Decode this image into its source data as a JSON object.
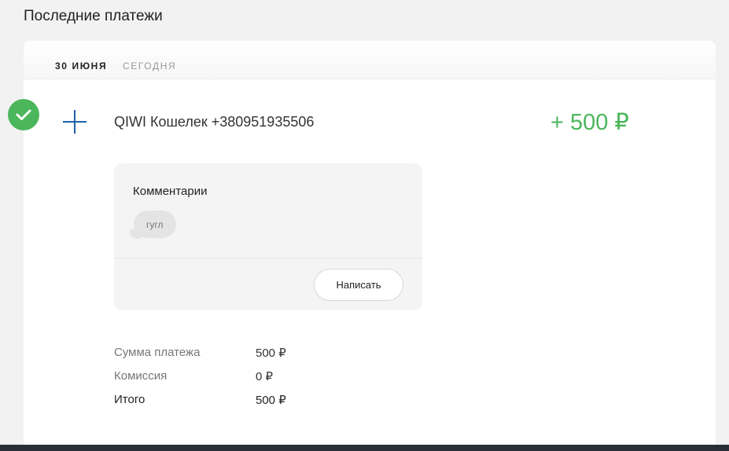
{
  "page": {
    "title": "Последние платежи"
  },
  "date_bar": {
    "date": "30 ИЮНЯ",
    "relative": "СЕГОДНЯ"
  },
  "payment": {
    "status_icon": "check-icon",
    "type_icon": "plus-icon",
    "payee": "QIWI Кошелек +380951935506",
    "amount": "+ 500 ₽",
    "amount_color": "#4cb65c"
  },
  "comments": {
    "title": "Комментарии",
    "items": [
      "гугл"
    ],
    "write_label": "Написать"
  },
  "details": [
    {
      "label": "Сумма платежа",
      "value": "500 ₽"
    },
    {
      "label": "Комиссия",
      "value": "0 ₽"
    },
    {
      "label": "Итого",
      "value": "500 ₽"
    }
  ]
}
